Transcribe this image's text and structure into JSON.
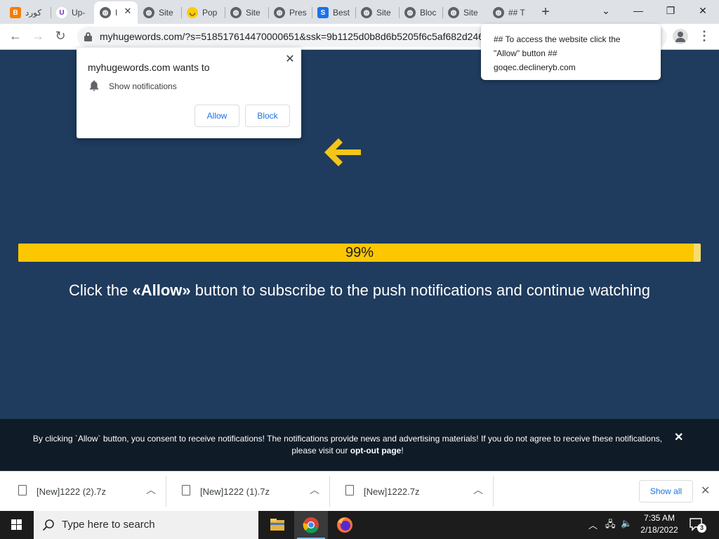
{
  "tabs": [
    {
      "title": "كورد",
      "icon": "blogger-icon",
      "color": "#f57d00"
    },
    {
      "title": "Up-",
      "icon": "upwork-icon",
      "color": "#ffffff"
    },
    {
      "title": "I",
      "icon": "globe-icon",
      "active_close": true
    },
    {
      "title": "Site",
      "icon": "globe-icon"
    },
    {
      "title": "Pop",
      "icon": "smiley-icon",
      "color": "#ffcc00"
    },
    {
      "title": "Site",
      "icon": "globe-icon"
    },
    {
      "title": "Pres",
      "icon": "globe-icon"
    },
    {
      "title": "Best",
      "icon": "s-logo-icon",
      "color": "#1a73e8"
    },
    {
      "title": "Site",
      "icon": "globe-icon"
    },
    {
      "title": "Bloc",
      "icon": "globe-icon"
    },
    {
      "title": "Site",
      "icon": "globe-icon"
    },
    {
      "title": "## T",
      "icon": "globe-icon"
    }
  ],
  "address_bar": {
    "url": "myhugewords.com/?s=518517614470000651&ssk=9b1125d0b8d6b5205f6c5af682d246"
  },
  "permission_popup": {
    "title": "myhugewords.com wants to",
    "permission": "Show notifications",
    "allow_label": "Allow",
    "block_label": "Block"
  },
  "tooltip": {
    "line1": "## To access the website click the",
    "line2": "\"Allow\" button ##",
    "line3": "goqec.declineryb.com"
  },
  "page": {
    "progress_text": "99%",
    "progress_value": 0.99,
    "headline_pre": "Click the ",
    "headline_bold": "«Allow»",
    "headline_post": " button to subscribe to the push notifications and continue watching",
    "accent": "#fdc700"
  },
  "consent": {
    "text": "By clicking `Allow` button, you consent to receive notifications! The notifications provide news and advertising materials! If you do not agree to receive these notifications, please visit our ",
    "link": "opt-out page",
    "end": "!"
  },
  "downloads": {
    "files": [
      "[New]1222 (2).7z",
      "[New]1222 (1).7z",
      "[New]1222.7z"
    ],
    "show_all": "Show all"
  },
  "taskbar": {
    "search_placeholder": "Type here to search",
    "time": "7:35 AM",
    "date": "2/18/2022",
    "notification_count": "3"
  }
}
